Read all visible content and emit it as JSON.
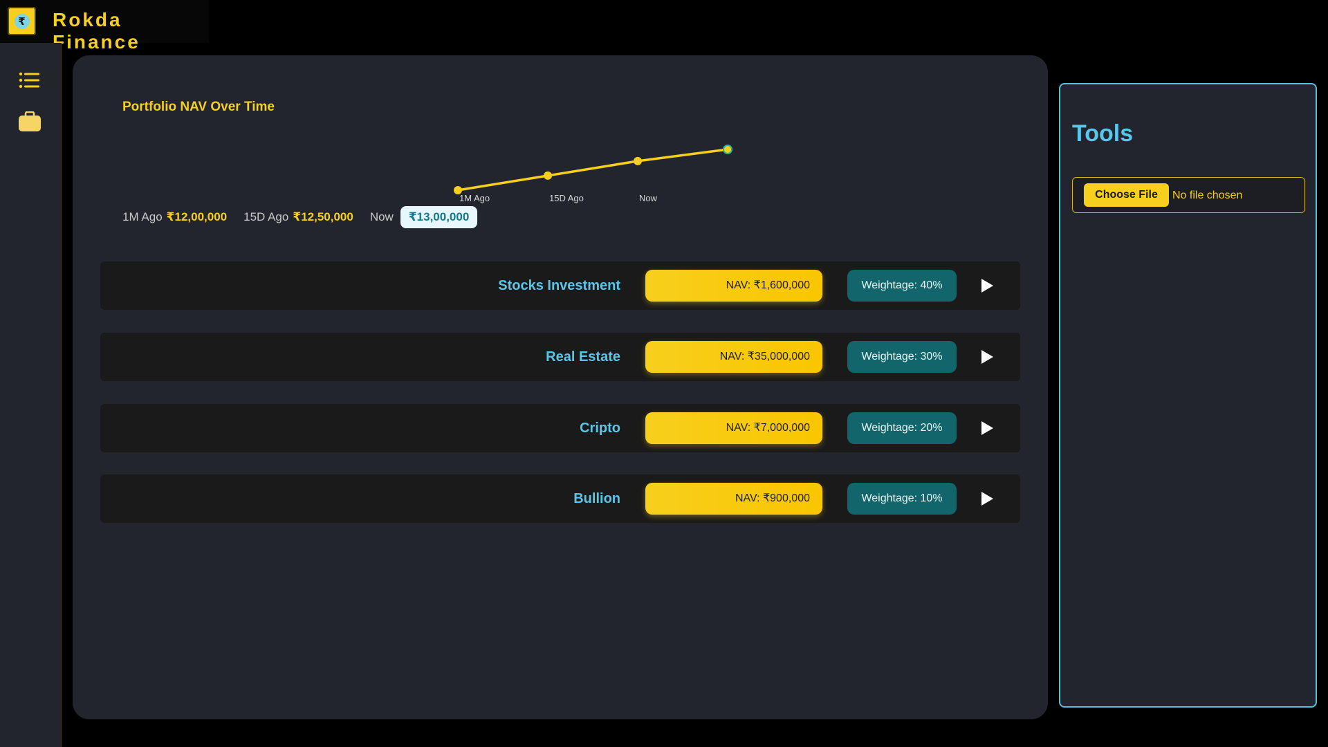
{
  "brand": {
    "name": "Rokda Finance",
    "logo_glyph": "₹",
    "colors": {
      "accent": "#f7cf1d",
      "secondary": "#59c6ec",
      "teal": "#12666b"
    }
  },
  "sidebar": {
    "items": [
      {
        "name": "list-icon"
      },
      {
        "name": "briefcase-icon"
      }
    ]
  },
  "chart_data": {
    "type": "line",
    "title": "Portfolio NAV Over Time",
    "x": [
      "1M Ago",
      "15D Ago",
      "Now"
    ],
    "series": [
      {
        "values": [
          1200000,
          1250000,
          1300000,
          1340000
        ]
      }
    ],
    "color": "#f7cf1d",
    "grid": false
  },
  "nav_summary": [
    {
      "label": "1M Ago",
      "value": "₹12,00,000"
    },
    {
      "label": "15D Ago",
      "value": "₹12,50,000"
    },
    {
      "label": "Now",
      "value": "₹13,00,000"
    }
  ],
  "assets": [
    {
      "name": "Stocks Investment",
      "nav": "NAV: ₹1,600,000",
      "weight": "Weightage: 40%"
    },
    {
      "name": "Real Estate",
      "nav": "NAV: ₹35,000,000",
      "weight": "Weightage: 30%"
    },
    {
      "name": "Cripto",
      "nav": "NAV: ₹7,000,000",
      "weight": "Weightage: 20%"
    },
    {
      "name": "Bullion",
      "nav": "NAV: ₹900,000",
      "weight": "Weightage: 10%"
    }
  ],
  "tools": {
    "title": "Tools",
    "choose_file_label": "Choose File",
    "file_status": "No file chosen"
  }
}
